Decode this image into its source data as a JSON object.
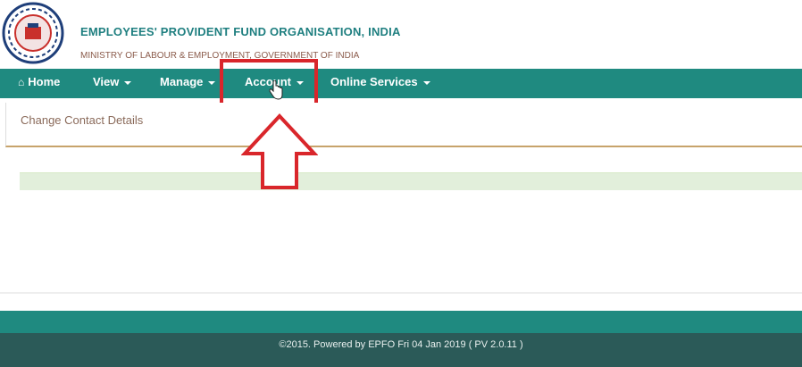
{
  "header": {
    "org_title": "EMPLOYEES' PROVIDENT FUND ORGANISATION, INDIA",
    "ministry": "MINISTRY OF LABOUR & EMPLOYMENT, GOVERNMENT OF INDIA",
    "logo_icon": "epfo-logo-icon"
  },
  "nav": {
    "home": "Home",
    "view": "View",
    "manage": "Manage",
    "account": "Account",
    "online_services": "Online Services"
  },
  "panel": {
    "title": "Change Contact Details"
  },
  "footer": {
    "text": "©2015. Powered by EPFO Fri 04 Jan 2019 ( PV 2.0.11 )"
  },
  "colors": {
    "nav_bg": "#1f8a80",
    "highlight": "#d9262b",
    "footer_bg": "#2b5a58",
    "title_color": "#1f7f80"
  }
}
